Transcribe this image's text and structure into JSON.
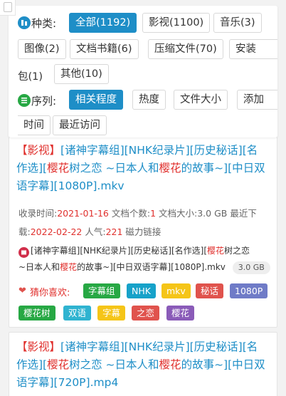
{
  "filters": {
    "type_label": "种类:",
    "type_chips": [
      "全部(1192)",
      "影视(1100)",
      "音乐(3)",
      "图像(2)",
      "文档书籍(6)",
      "压缩文件(70)",
      "安装包(1)",
      "其他(10)"
    ],
    "install_part1": "安装",
    "install_part2": "包(1)",
    "sort_label": "序列:",
    "sort_chips": [
      "相关程度",
      "热度",
      "文件大小",
      "添加时间",
      "最近访问"
    ],
    "add_part1": "添加",
    "add_part2": "时间"
  },
  "results": [
    {
      "title_tag": "【影视】",
      "title_l1a": "[诸神字幕组][NHK纪录片][历史秘话][名",
      "title_l2a": "作选][",
      "title_hl1": "樱花",
      "title_l2b": "树之恋 ~日本人和",
      "title_hl2": "樱花",
      "title_l2c": "的故事~][中日双",
      "title_l3": "语字幕][1080P].mkv",
      "meta_l1_a": "收录时间:",
      "meta_date": "2021-01-16",
      "meta_l1_b": "文档个数:",
      "meta_count": "1",
      "meta_l1_c": "文档大小:3.0 GB",
      "meta_l1_d": "最近下",
      "meta_l2_a": "载:",
      "meta_recent": "2022-02-22",
      "meta_l2_b": "人气:",
      "meta_pop": "221",
      "meta_l2_c": "磁力链接",
      "path_a": "[诸神字幕组][NHK纪录片][历史秘话][名作选][",
      "path_hl1": "樱花",
      "path_b": "树之恋",
      "path_c": "~日本人和",
      "path_hl2": "樱花",
      "path_d": "的故事~][中日双语字幕][1080P].mkv",
      "path_size": "3.0 GB",
      "like_label": "猜你喜欢:",
      "tags": [
        "字幕组",
        "NHK",
        "mkv",
        "秘话",
        "1080P",
        "樱花树",
        "双语",
        "字幕",
        "之恋",
        "樱花"
      ]
    },
    {
      "title_tag": "【影视】",
      "title_l1a": "[诸神字幕组][NHK纪录片][历史秘话][名",
      "title_l2a": "作选][",
      "title_hl1": "樱花",
      "title_l2b": "树之恋 ~日本人和",
      "title_hl2": "樱花",
      "title_l2c": "的故事~][中日双",
      "title_l3": "语字幕][720P].mp4"
    }
  ],
  "colors": {
    "accent": "#1e8ec7",
    "highlight": "#e0302d",
    "tag_colors": [
      "#27a844",
      "#17a2c9",
      "#f5c518",
      "#e0534d",
      "#6f7bc7",
      "#27a844",
      "#2fb3d0",
      "#f5c518",
      "#e0534d",
      "#8a5bb8"
    ]
  }
}
